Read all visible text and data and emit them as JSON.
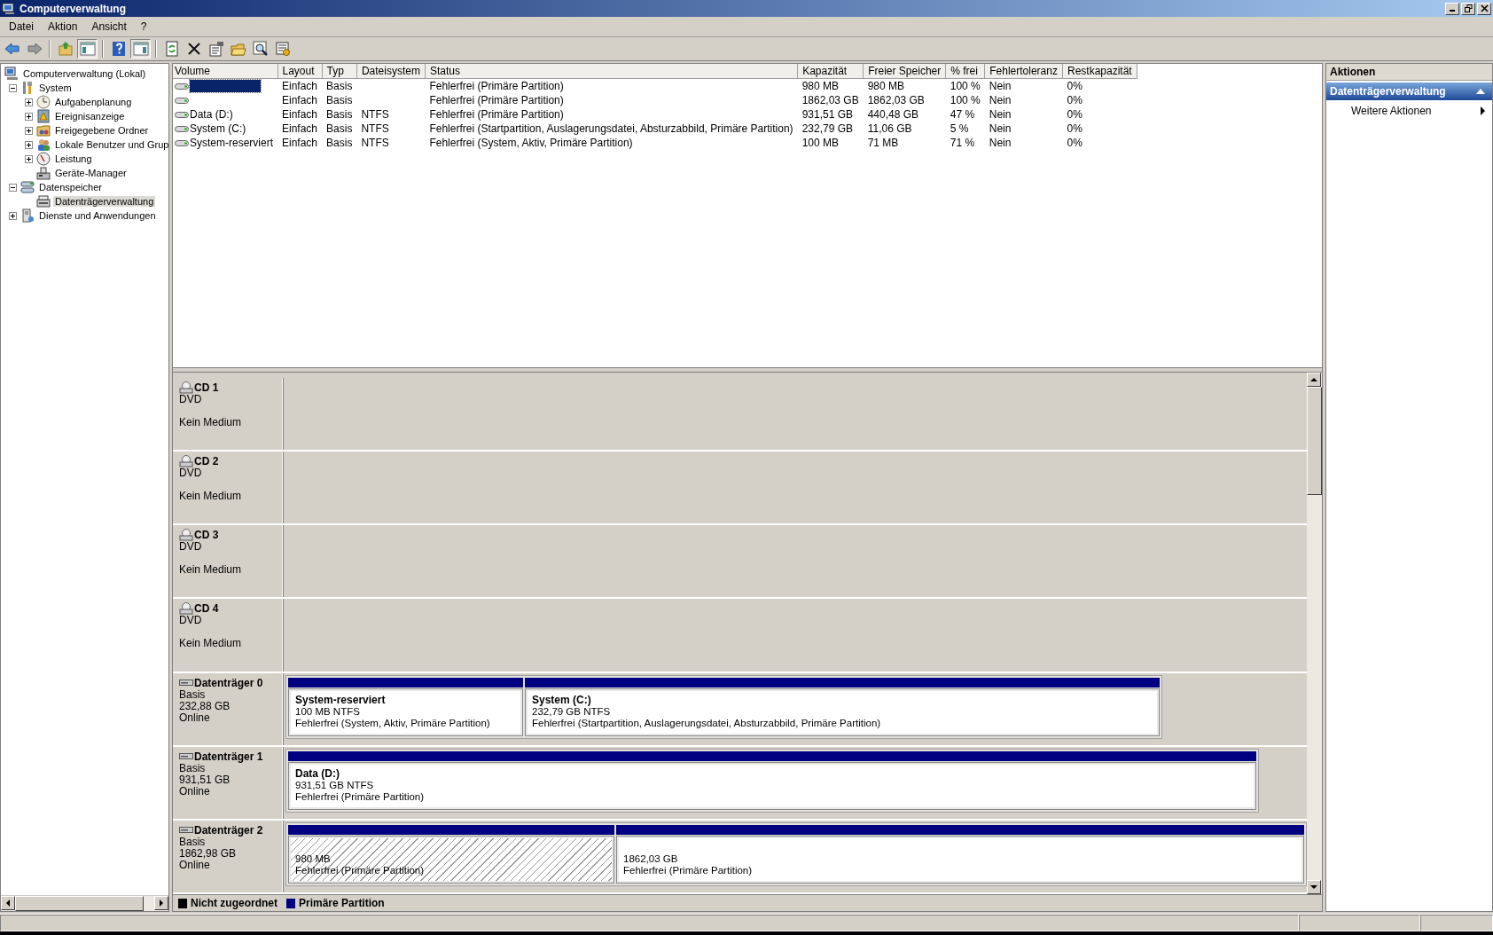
{
  "window": {
    "title": "Computerverwaltung"
  },
  "menu": [
    "Datei",
    "Aktion",
    "Ansicht",
    "?"
  ],
  "toolbar": [
    {
      "pressed": false
    },
    {
      "pressed": false
    },
    {
      "pressed": false
    },
    {
      "pressed": true
    },
    {
      "pressed": false
    },
    {
      "pressed": true
    },
    {
      "pressed": false
    },
    {
      "pressed": false
    },
    {
      "pressed": false
    },
    {
      "pressed": false
    },
    {
      "pressed": false
    },
    {
      "pressed": false
    }
  ],
  "tree": [
    {
      "label": "Computerverwaltung (Lokal)",
      "kind": "computer",
      "selected": false,
      "children": [
        {
          "label": "System",
          "kind": "tools",
          "expanded": true,
          "selected": false,
          "children": [
            {
              "label": "Aufgabenplanung",
              "kind": "clock",
              "expanded": false,
              "selected": false
            },
            {
              "label": "Ereignisanzeige",
              "kind": "event",
              "expanded": false,
              "selected": false
            },
            {
              "label": "Freigegebene Ordner",
              "kind": "share",
              "expanded": false,
              "selected": false
            },
            {
              "label": "Lokale Benutzer und Grup",
              "kind": "users",
              "expanded": false,
              "selected": false
            },
            {
              "label": "Leistung",
              "kind": "gauge",
              "expanded": false,
              "selected": false
            },
            {
              "label": "Geräte-Manager",
              "kind": "device",
              "selected": false
            }
          ]
        },
        {
          "label": "Datenspeicher",
          "kind": "storage",
          "expanded": true,
          "selected": false,
          "children": [
            {
              "label": "Datenträgerverwaltung",
              "kind": "disk",
              "selected": true
            }
          ]
        },
        {
          "label": "Dienste und Anwendungen",
          "kind": "services",
          "expanded": false,
          "selected": false
        }
      ]
    }
  ],
  "table": {
    "columns": [
      "Volume",
      "Layout",
      "Typ",
      "Dateisystem",
      "Status",
      "Kapazität",
      "Freier Speicher",
      "% frei",
      "Fehlertoleranz",
      "Restkapazität"
    ],
    "rows": [
      {
        "selected": true,
        "cells": [
          null,
          "Einfach",
          "Basis",
          null,
          "Fehlerfrei (Primäre Partition)",
          "980 MB",
          "980 MB",
          "100 %",
          "Nein",
          "0%"
        ]
      },
      {
        "selected": false,
        "cells": [
          null,
          "Einfach",
          "Basis",
          null,
          "Fehlerfrei (Primäre Partition)",
          "1862,03 GB",
          "1862,03 GB",
          "100 %",
          "Nein",
          "0%"
        ]
      },
      {
        "selected": false,
        "cells": [
          "Data (D:)",
          "Einfach",
          "Basis",
          "NTFS",
          "Fehlerfrei (Primäre Partition)",
          "931,51 GB",
          "440,48 GB",
          "47 %",
          "Nein",
          "0%"
        ]
      },
      {
        "selected": false,
        "cells": [
          "System (C:)",
          "Einfach",
          "Basis",
          "NTFS",
          "Fehlerfrei (Startpartition, Auslagerungsdatei, Absturzabbild, Primäre Partition)",
          "232,79 GB",
          "11,06 GB",
          "5 %",
          "Nein",
          "0%"
        ]
      },
      {
        "selected": false,
        "cells": [
          "System-reserviert",
          "Einfach",
          "Basis",
          "NTFS",
          "Fehlerfrei (System, Aktiv, Primäre Partition)",
          "100 MB",
          "71 MB",
          "71 %",
          "Nein",
          "0%"
        ]
      }
    ]
  },
  "disks": [
    {
      "kind": "cd",
      "name": "CD 1",
      "type": "DVD",
      "status": "Kein Medium"
    },
    {
      "kind": "cd",
      "name": "CD 2",
      "type": "DVD",
      "status": "Kein Medium"
    },
    {
      "kind": "cd",
      "name": "CD 3",
      "type": "DVD",
      "status": "Kein Medium"
    },
    {
      "kind": "cd",
      "name": "CD 4",
      "type": "DVD",
      "status": "Kein Medium"
    },
    {
      "kind": "disk",
      "name": "Datenträger 0",
      "type": "Basis",
      "size": "232,88 GB",
      "status": "Online",
      "partitions": [
        {
          "name": "System-reserviert",
          "detail": "100 MB NTFS",
          "status": "Fehlerfrei (System, Aktiv, Primäre Partition)",
          "selected": false
        },
        {
          "name": "System  (C:)",
          "detail": "232,79 GB NTFS",
          "status": "Fehlerfrei (Startpartition, Auslagerungsdatei, Absturzabbild, Primäre Partition)",
          "selected": false
        }
      ]
    },
    {
      "kind": "disk",
      "name": "Datenträger 1",
      "type": "Basis",
      "size": "931,51 GB",
      "status": "Online",
      "partitions": [
        {
          "name": "Data  (D:)",
          "detail": "931,51 GB NTFS",
          "status": "Fehlerfrei (Primäre Partition)",
          "selected": false
        }
      ]
    },
    {
      "kind": "disk",
      "name": "Datenträger 2",
      "type": "Basis",
      "size": "1862,98 GB",
      "status": "Online",
      "partitions": [
        {
          "detail": "980 MB",
          "status": "Fehlerfrei (Primäre Partition)",
          "selected": true
        },
        {
          "detail": "1862,03 GB",
          "status": "Fehlerfrei (Primäre Partition)",
          "selected": false
        }
      ]
    }
  ],
  "legend": [
    {
      "label": "Nicht zugeordnet",
      "color": "#000000"
    },
    {
      "label": "Primäre Partition",
      "color": "#000080"
    }
  ],
  "actions": {
    "title": "Aktionen",
    "section": {
      "label": "Datenträgerverwaltung",
      "expanded": true
    },
    "items": [
      "Weitere Aktionen"
    ]
  }
}
